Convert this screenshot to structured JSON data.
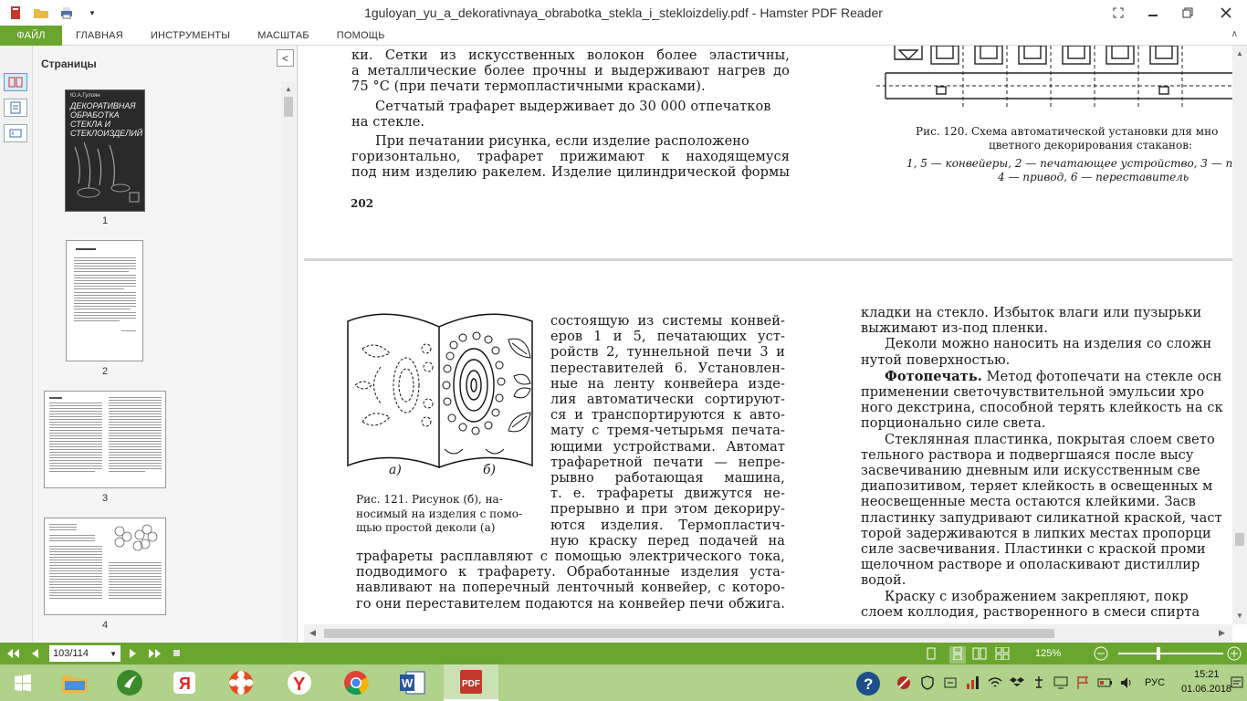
{
  "window": {
    "title": "1guloyan_yu_a_dekorativnaya_obrabotka_stekla_i_stekloizdeliy.pdf - Hamster PDF Reader"
  },
  "ribbon": {
    "tabs": [
      "ФАЙЛ",
      "ГЛАВНАЯ",
      "ИНСТРУМЕНТЫ",
      "МАСШТАБ",
      "ПОМОЩЬ"
    ]
  },
  "pages_panel": {
    "title": "Страницы",
    "close_label": "<",
    "thumbnails": [
      {
        "num": "1",
        "cover_title": "ДЕКОРАТИВНАЯ ОБРАБОТКА СТЕКЛА И СТЕКЛОИЗДЕЛИЙ",
        "cover_author": "Ю.А.Гулоян"
      },
      {
        "num": "2"
      },
      {
        "num": "3"
      },
      {
        "num": "4"
      }
    ]
  },
  "document": {
    "top_page": {
      "lines": [
        "ки. Сетки из искусственных волокон более эластичны,",
        "а металлические более прочны и выдерживают нагрев до",
        "75 °С (при печати термопластичными красками).",
        "Сетчатый трафарет выдерживает до 30 000 отпечатков",
        "на стекле.",
        "При печатании рисунка, если изделие расположено",
        "горизонтально, трафарет прижимают к находящемуся",
        "под ним изделию ракелем. Изделие цилиндрической формы"
      ],
      "page_number": "202",
      "fig120_caption": [
        "Рис. 120. Схема автоматической установки для мно",
        "цветного декорирования стаканов:",
        "1, 5 — конвейеры, 2 — печатающее устройство, 3 — п",
        "4 — привод, 6 — переставитель"
      ]
    },
    "bottom_page": {
      "fig_labels": [
        "а)",
        "б)"
      ],
      "fig121_caption": [
        "Рис. 121. Рисунок (б), на-",
        "носимый на изделия с помо-",
        "щью простой деколи (а)"
      ],
      "column_right_of_figure": [
        "состоящую из системы конвей-",
        "еров 1 и 5, печатающих уст-",
        "ройств 2, туннельной печи 3 и",
        "переставителей 6. Установлен-",
        "ные на ленту конвейера изде-",
        "лия автоматически сортируют-",
        "ся и транспортируются к авто-",
        "мату с тремя-четырьмя печата-",
        "ющими устройствами. Автомат",
        "трафаретной печати — непре-",
        "рывно работающая машина,",
        "т. е. трафареты движутся не-",
        "прерывно и при этом декориру-",
        "ются изделия. Термопластич-",
        "ную краску перед подачей на"
      ],
      "column_full_width": [
        "трафареты расплавляют с помощью электрического тока,",
        "подводимого к трафарету. Обработанные изделия уста-",
        "навливают на поперечный ленточный конвейер, с которо-",
        "го они переставителем подаются на конвейер печи обжига."
      ],
      "right_column": [
        "кладки на стекло. Избыток влаги или пузырьки",
        "выжимают из-под пленки.",
        "Деколи можно наносить на изделия со сложн",
        "нутой поверхностью.",
        "Метод фотопечати на стекле осн",
        "применении светочувствительной эмульсии хро",
        "ного декстрина, способной терять клейкость на ск",
        "порционально силе света.",
        "Стеклянная пластинка, покрытая слоем свето",
        "тельного раствора и подвергшаяся после высу",
        "засвечиванию дневным или искусственным све",
        "диапозитивом, теряет клейкость в освещенных м",
        "неосвещенные места остаются клейкими. Засв",
        "пластинку запудривают силикатной краской, част",
        "торой задерживаются в липких местах пропорци",
        "силе засвечивания. Пластинки с краской проми",
        "щелочном растворе и ополаскивают дистиллир",
        "водой.",
        "Краску с изображением закрепляют, покр",
        "слоем коллодия, растворенного в смеси спирта"
      ],
      "right_column_bold": "Фотопечать."
    }
  },
  "statusbar": {
    "page_indicator": "103/114",
    "zoom_level": "125%",
    "zoom_fraction": 0.38,
    "accent_color": "#6aa62f"
  },
  "taskbar": {
    "apps": [
      "file-explorer",
      "evernote",
      "yandex-browser",
      "colorful-app",
      "yandex",
      "chrome",
      "word",
      "pdf-reader"
    ],
    "language": "РУС",
    "time": "15:21",
    "date": "01.06.2018"
  }
}
